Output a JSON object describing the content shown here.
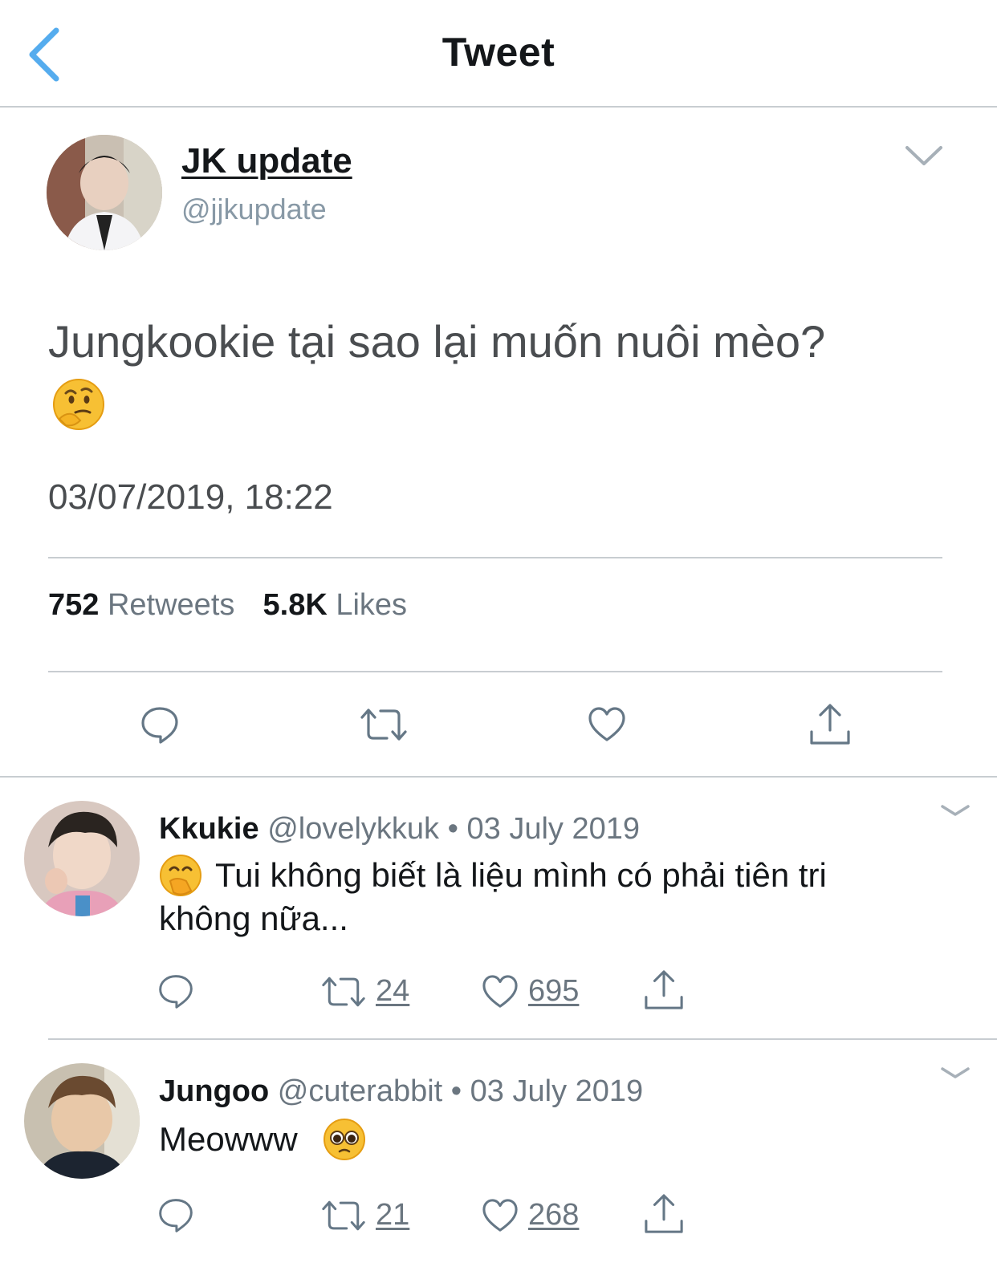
{
  "header": {
    "title": "Tweet"
  },
  "tweet": {
    "author_name": "JK update",
    "author_handle": "@jjkupdate",
    "text": "Jungkookie tại sao lại muốn nuôi mèo?",
    "emoji": "thinking-face",
    "timestamp": "03/07/2019, 18:22",
    "retweets_count": "752",
    "retweets_label": "Retweets",
    "likes_count": "5.8K",
    "likes_label": "Likes"
  },
  "replies": [
    {
      "name": "Kkukie",
      "handle": "@lovelykkuk",
      "separator": "•",
      "date": "03 July 2019",
      "emoji": "face-with-hand-over-mouth",
      "text_line1": "Tui không biết là liệu mình có phải tiên tri",
      "text_line2": "không nữa...",
      "retweets": "24",
      "likes": "695"
    },
    {
      "name": "Jungoo",
      "handle": "@cuterabbit",
      "separator": "•",
      "date": "03 July 2019",
      "text": "Meowww",
      "emoji": "pleading-face",
      "retweets": "21",
      "likes": "268"
    }
  ],
  "colors": {
    "accent": "#55acee",
    "icon_gray": "#657786",
    "divider": "#c8cdd1"
  }
}
